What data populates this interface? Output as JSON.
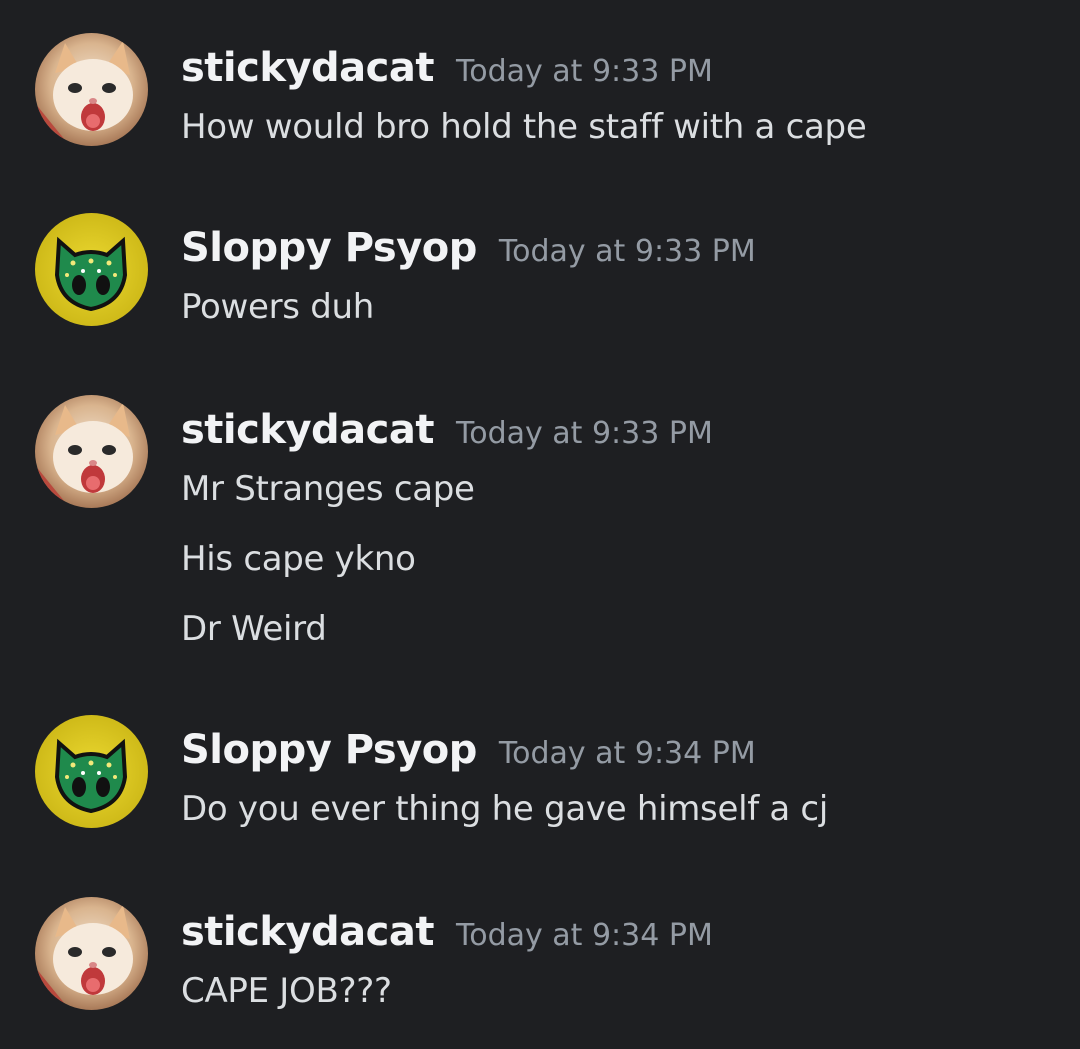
{
  "messages": [
    {
      "author": "stickydacat",
      "avatar_icon": "kitten-avatar-icon",
      "timestamp": "Today at 9:33 PM",
      "lines": [
        "How would bro hold the staff with a cape"
      ]
    },
    {
      "author": "Sloppy Psyop",
      "avatar_icon": "green-mask-avatar-icon",
      "timestamp": "Today at 9:33 PM",
      "lines": [
        "Powers duh"
      ]
    },
    {
      "author": "stickydacat",
      "avatar_icon": "kitten-avatar-icon",
      "timestamp": "Today at 9:33 PM",
      "lines": [
        "Mr Stranges cape",
        "His cape ykno",
        "Dr Weird"
      ]
    },
    {
      "author": "Sloppy Psyop",
      "avatar_icon": "green-mask-avatar-icon",
      "timestamp": "Today at 9:34 PM",
      "lines": [
        "Do you ever thing he gave himself a cj"
      ]
    },
    {
      "author": "stickydacat",
      "avatar_icon": "kitten-avatar-icon",
      "timestamp": "Today at 9:34 PM",
      "lines": [
        "CAPE JOB???"
      ]
    }
  ],
  "colors": {
    "background": "#1e1f22",
    "username": "#f2f3f5",
    "timestamp": "#949ba4",
    "message_text": "#dbdee1",
    "mask_avatar_bg": "#d8c41a",
    "mask_green": "#1f8a4c"
  }
}
